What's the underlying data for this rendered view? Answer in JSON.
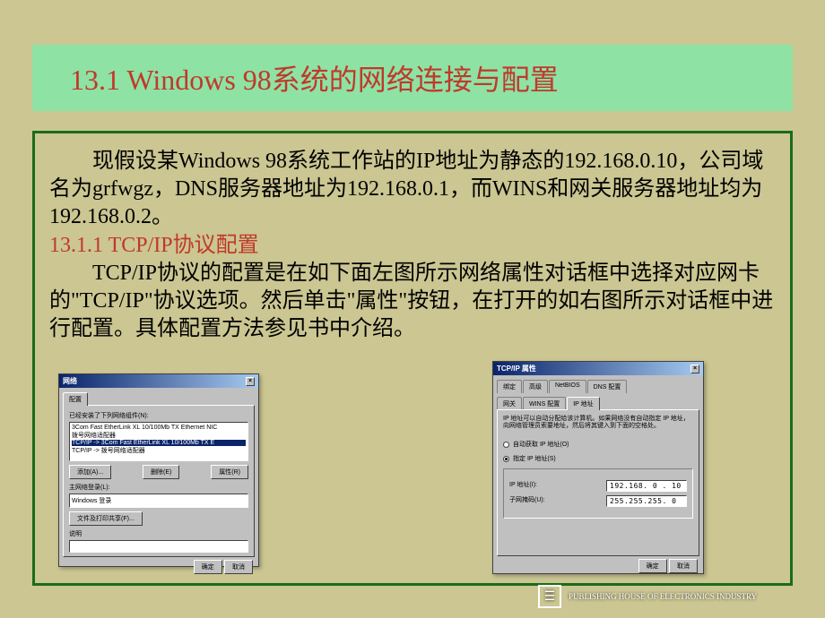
{
  "title": "13.1  Windows 98系统的网络连接与配置",
  "body": {
    "para1": "现假设某Windows 98系统工作站的IP地址为静态的192.168.0.10，公司域名为grfwgz，DNS服务器地址为192.168.0.1，而WINS和网关服务器地址均为192.168.0.2。",
    "subhead": "13.1.1  TCP/IP协议配置",
    "para2": "TCP/IP协议的配置是在如下面左图所示网络属性对话框中选择对应网卡的\"TCP/IP\"协议选项。然后单击\"属性\"按钮，在打开的如右图所示对话框中进行配置。具体配置方法参见书中介绍。"
  },
  "dialog_left": {
    "title": "网络",
    "tab_config": "配置",
    "list_label": "已经安装了下列网络组件(N):",
    "items": [
      "3Com Fast EtherLink XL 10/100Mb TX Ethernet NIC",
      "拨号网络适配器",
      "TCP/IP -> 3Com Fast EtherLink XL 10/100Mb TX E",
      "TCP/IP -> 拨号网络适配器"
    ],
    "btn_add": "添加(A)...",
    "btn_remove": "删除(E)",
    "btn_prop": "属性(R)",
    "login_label": "主网络登录(L):",
    "login_value": "Windows 登录",
    "btn_share": "文件及打印共享(F)...",
    "desc_label": "说明",
    "btn_ok": "确定",
    "btn_cancel": "取消"
  },
  "dialog_right": {
    "title": "TCP/IP 属性",
    "tabs_row1": [
      "绑定",
      "高级",
      "NetBIOS",
      "DNS 配置"
    ],
    "tabs_row2": [
      "网关",
      "WINS 配置",
      "IP 地址"
    ],
    "info": "IP 地址可以自动分配给该计算机。如果网络没有自动指定 IP 地址，向网络管理员索要地址，然后将其键入到下面的空格处。",
    "radio_auto": "自动获取 IP 地址(O)",
    "radio_manual": "指定 IP 地址(S)",
    "ip_label": "IP 地址(I):",
    "ip_value": "192.168. 0 . 10",
    "mask_label": "子网掩码(U):",
    "mask_value": "255.255.255. 0",
    "btn_ok": "确定",
    "btn_cancel": "取消"
  },
  "footer": {
    "publisher_en": "PUBLISHING HOUSE OF ELECTRONICS INDUSTRY"
  }
}
